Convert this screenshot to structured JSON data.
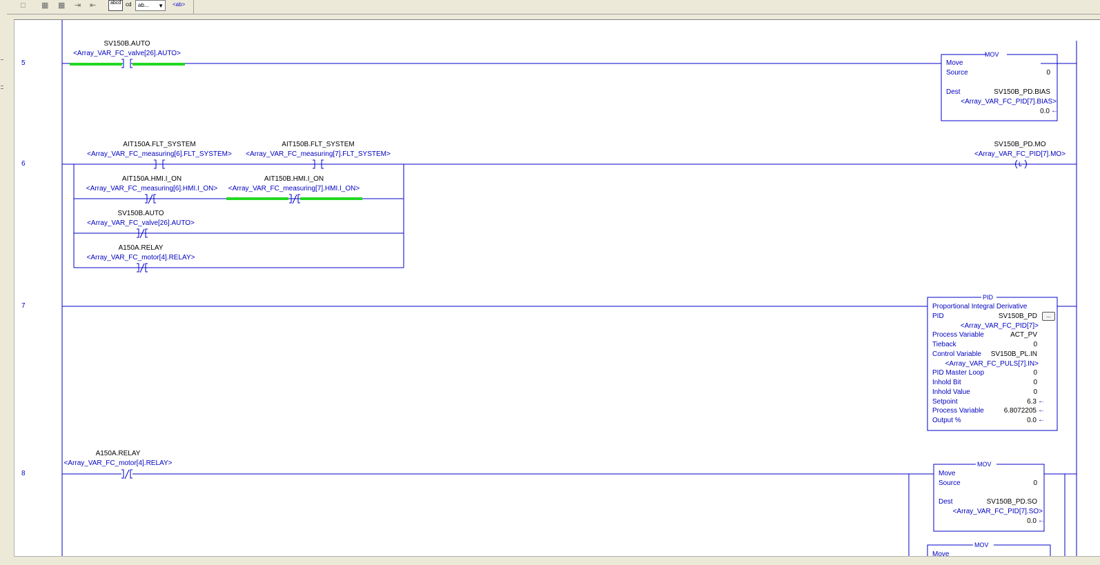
{
  "toolbar": {
    "items": [
      {
        "name": "rung-icon",
        "glyph": "❐"
      },
      {
        "name": "branch-icon",
        "glyph": "❑"
      },
      {
        "name": "branch-level-icon",
        "glyph": "❒"
      },
      {
        "name": "export-icon",
        "glyph": "⇥"
      },
      {
        "name": "import-icon",
        "glyph": "⇤"
      }
    ],
    "abcd_label": "abcd",
    "cd_label": "cd",
    "dropdown_label": "ab...",
    "ab_tag": "<ab>"
  },
  "rungs": {
    "r5": {
      "number": "5",
      "contact": {
        "tag": "SV150B.AUTO",
        "alias": "<Array_VAR_FC_valve[26].AUTO>"
      },
      "mov": {
        "title": "MOV",
        "name": "Move",
        "source_label": "Source",
        "source_value": "0",
        "dest_label": "Dest",
        "dest_tag": "SV150B_PD.BIAS",
        "dest_alias": "<Array_VAR_FC_PID[7].BIAS>",
        "dest_value": "0.0"
      }
    },
    "r6": {
      "number": "6",
      "contacts": [
        {
          "tag": "AIT150A.FLT_SYSTEM",
          "alias": "<Array_VAR_FC_measuring[6].FLT_SYSTEM>"
        },
        {
          "tag": "AIT150B.FLT_SYSTEM",
          "alias": "<Array_VAR_FC_measuring[7].FLT_SYSTEM>"
        },
        {
          "tag": "AIT150A.HMI.I_ON",
          "alias": "<Array_VAR_FC_measuring[6].HMI.I_ON>"
        },
        {
          "tag": "AIT150B.HMI.I_ON",
          "alias": "<Array_VAR_FC_measuring[7].HMI.I_ON>"
        },
        {
          "tag": "SV150B.AUTO",
          "alias": "<Array_VAR_FC_valve[26].AUTO>"
        },
        {
          "tag": "A150A.RELAY",
          "alias": "<Array_VAR_FC_motor[4].RELAY>"
        }
      ],
      "coil": {
        "tag": "SV150B_PD.MO",
        "alias": "<Array_VAR_FC_PID[7].MO>",
        "type": "L"
      }
    },
    "r7": {
      "number": "7",
      "pid": {
        "title": "PID",
        "name": "Proportional Integral Derivative",
        "rows": [
          {
            "label": "PID",
            "value": "SV150B_PD"
          },
          {
            "label": "",
            "value": "<Array_VAR_FC_PID[7]>"
          },
          {
            "label": "Process Variable",
            "value": "ACT_PV"
          },
          {
            "label": "Tieback",
            "value": "0"
          },
          {
            "label": "Control Variable",
            "value": "SV150B_PL.IN"
          },
          {
            "label": "",
            "value": "<Array_VAR_FC_PULS[7].IN>"
          },
          {
            "label": "PID Master Loop",
            "value": "0"
          },
          {
            "label": "Inhold Bit",
            "value": "0"
          },
          {
            "label": "Inhold Value",
            "value": "0"
          },
          {
            "label": "Setpoint",
            "value": "6.3"
          },
          {
            "label": "Process Variable",
            "value": "6.8072205"
          },
          {
            "label": "Output %",
            "value": "0.0"
          }
        ],
        "more_button": "..."
      }
    },
    "r8": {
      "number": "8",
      "contact": {
        "tag": "A150A.RELAY",
        "alias": "<Array_VAR_FC_motor[4].RELAY>"
      },
      "mov": {
        "title": "MOV",
        "name": "Move",
        "source_label": "Source",
        "source_value": "0",
        "dest_label": "Dest",
        "dest_tag": "SV150B_PD.SO",
        "dest_alias": "<Array_VAR_FC_PID[7].SO>",
        "dest_value": "0.0"
      },
      "mov2": {
        "title": "MOV",
        "name": "Move"
      }
    }
  },
  "colors": {
    "rung": "#0000c8",
    "energized": "#22d822",
    "text": "#000000",
    "alias": "#0000c0"
  }
}
